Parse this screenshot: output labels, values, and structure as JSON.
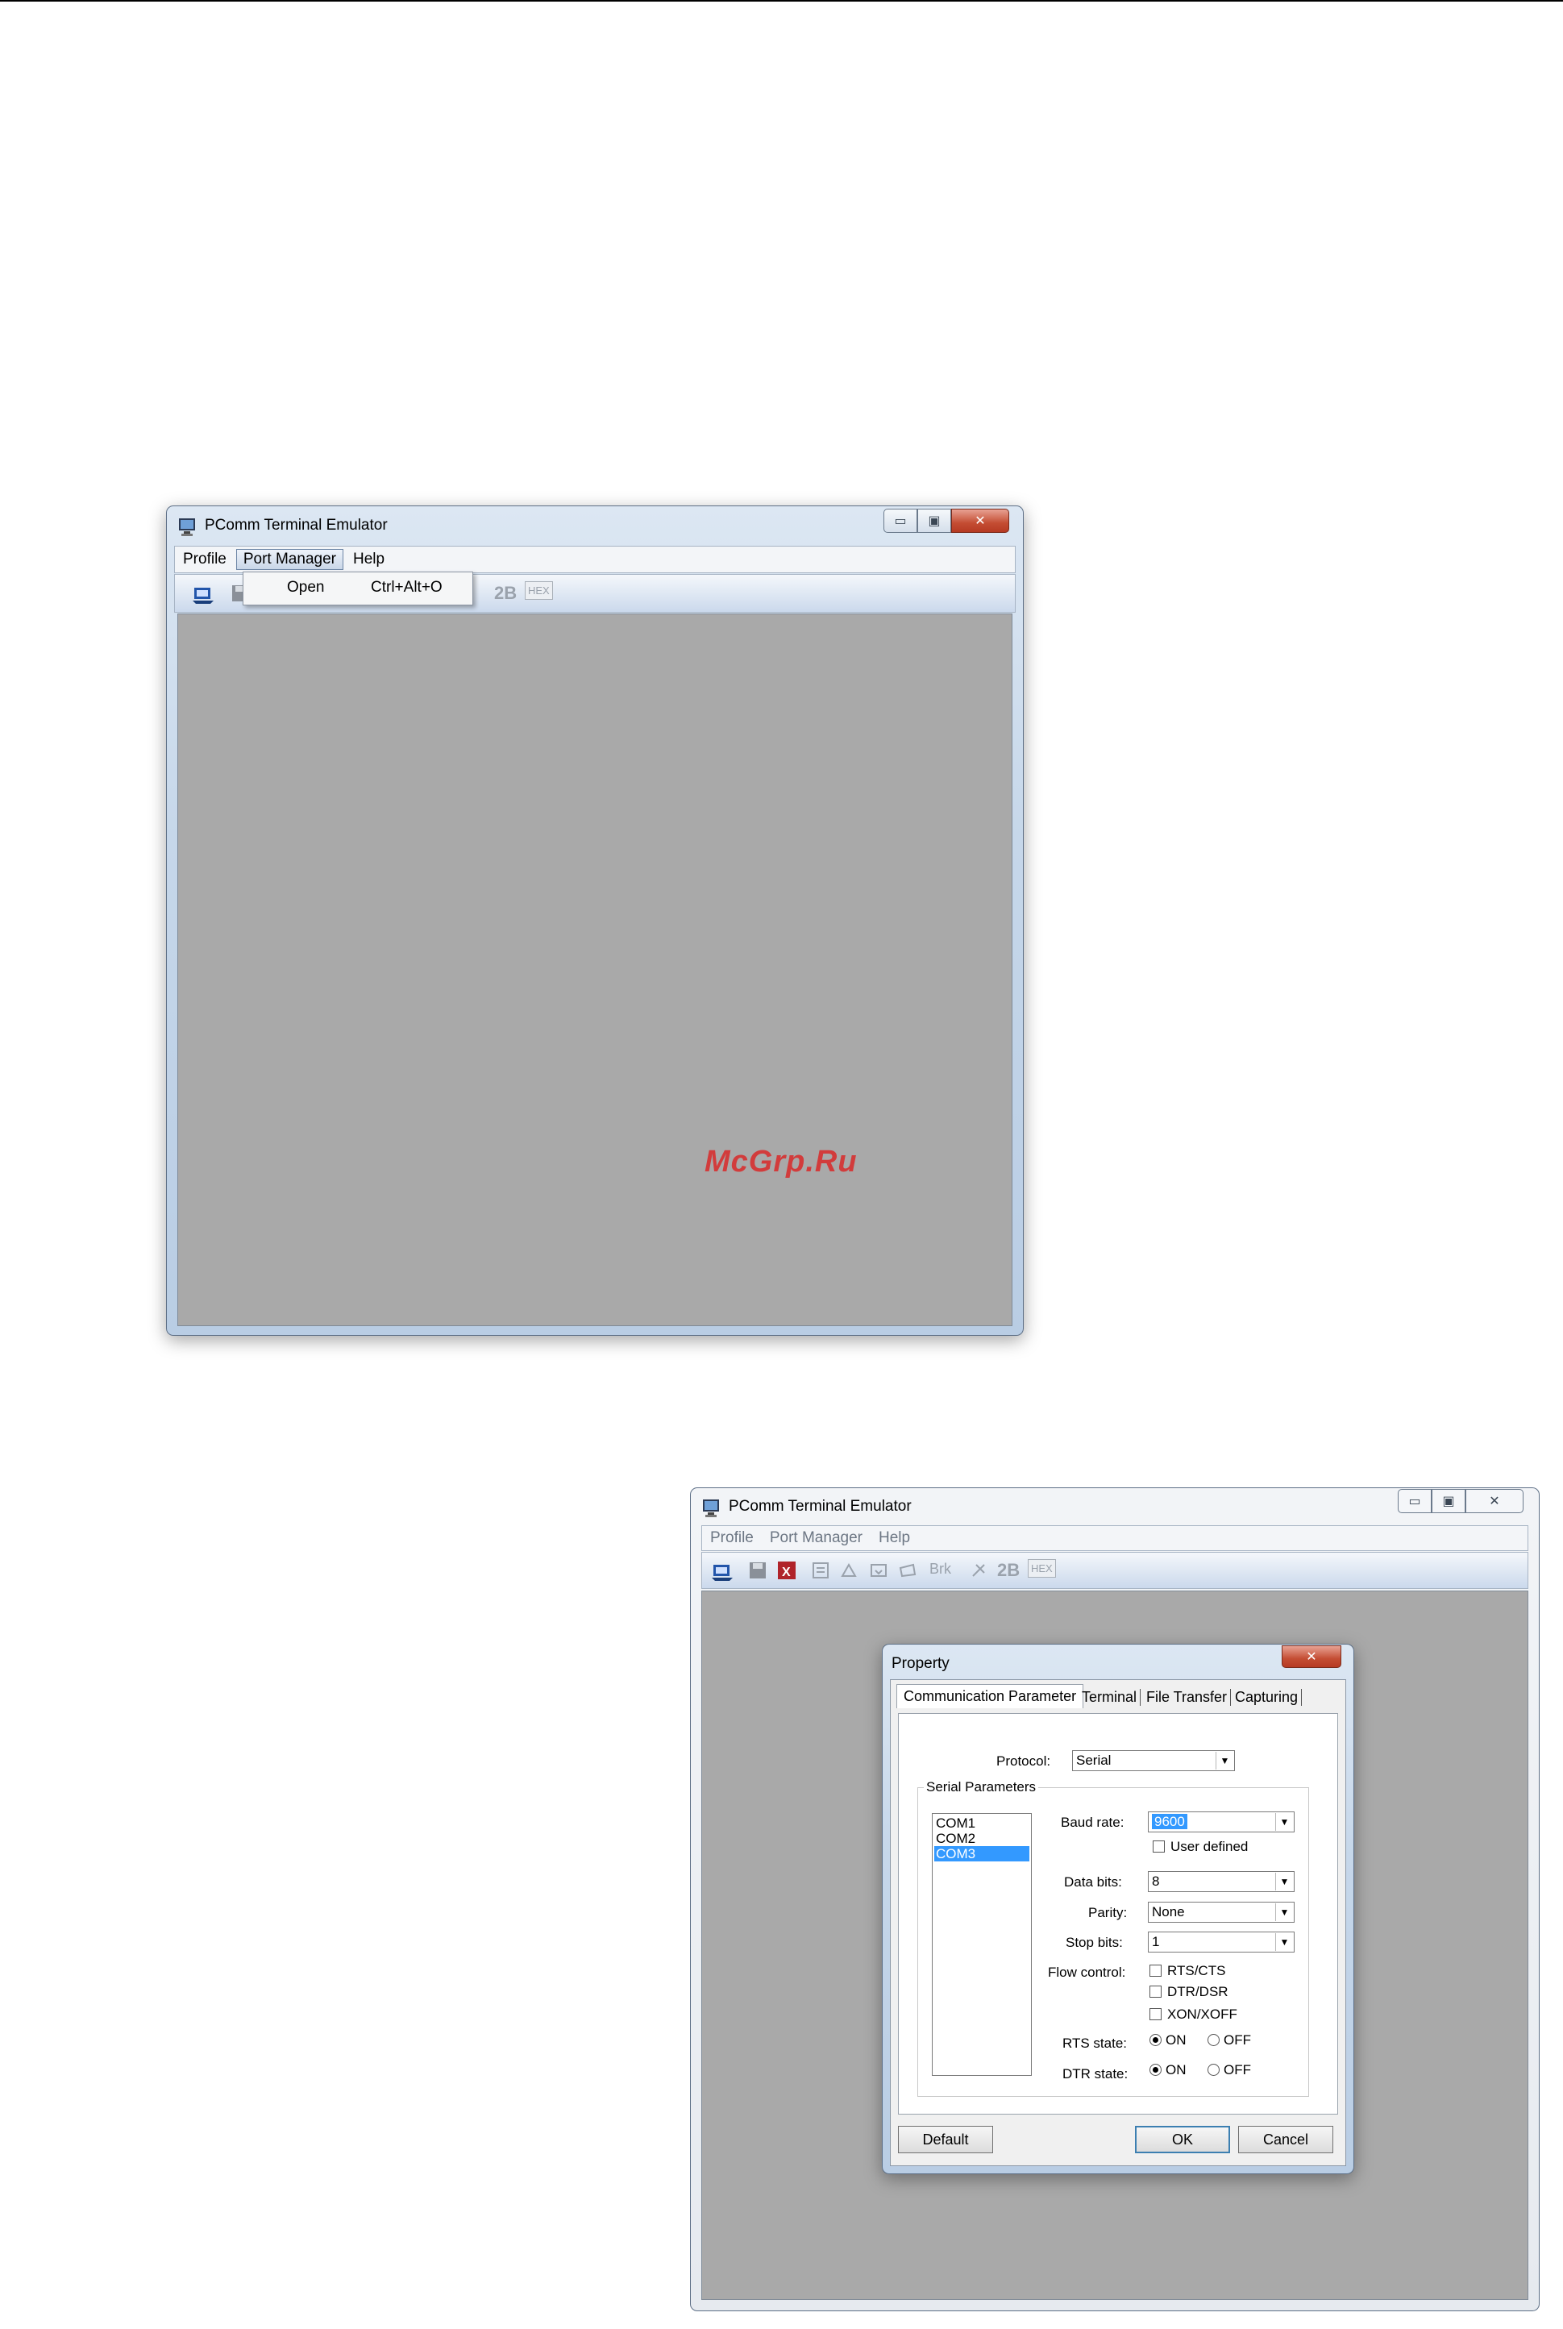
{
  "window1": {
    "title": "PComm Terminal Emulator",
    "menu": {
      "profile": "Profile",
      "port_manager": "Port Manager",
      "help": "Help"
    },
    "port_menu": {
      "item": "Open",
      "shortcut": "Ctrl+Alt+O"
    },
    "toolbar": {
      "b2": "2B",
      "hex": "HEX"
    }
  },
  "watermark": "McGrp.Ru",
  "window2": {
    "title": "PComm Terminal Emulator",
    "menu": {
      "profile": "Profile",
      "port_manager": "Port Manager",
      "help": "Help"
    },
    "toolbar": {
      "brk": "Brk",
      "b2": "2B",
      "hex": "HEX"
    }
  },
  "dialog": {
    "title": "Property",
    "tabs": [
      "Communication Parameter",
      "Terminal",
      "File Transfer",
      "Capturing"
    ],
    "protocol_label": "Protocol:",
    "protocol_value": "Serial",
    "group_title": "Serial Parameters",
    "ports": [
      "COM1",
      "COM2",
      "COM3"
    ],
    "selected_port": "COM3",
    "baud_label": "Baud rate:",
    "baud_value": "9600",
    "user_defined": "User defined",
    "databits_label": "Data bits:",
    "databits_value": "8",
    "parity_label": "Parity:",
    "parity_value": "None",
    "stopbits_label": "Stop bits:",
    "stopbits_value": "1",
    "flow_label": "Flow control:",
    "flow_options": [
      "RTS/CTS",
      "DTR/DSR",
      "XON/XOFF"
    ],
    "rts_label": "RTS state:",
    "dtr_label": "DTR state:",
    "on": "ON",
    "off": "OFF",
    "rts_state": "ON",
    "dtr_state": "ON",
    "buttons": {
      "default": "Default",
      "ok": "OK",
      "cancel": "Cancel"
    }
  }
}
